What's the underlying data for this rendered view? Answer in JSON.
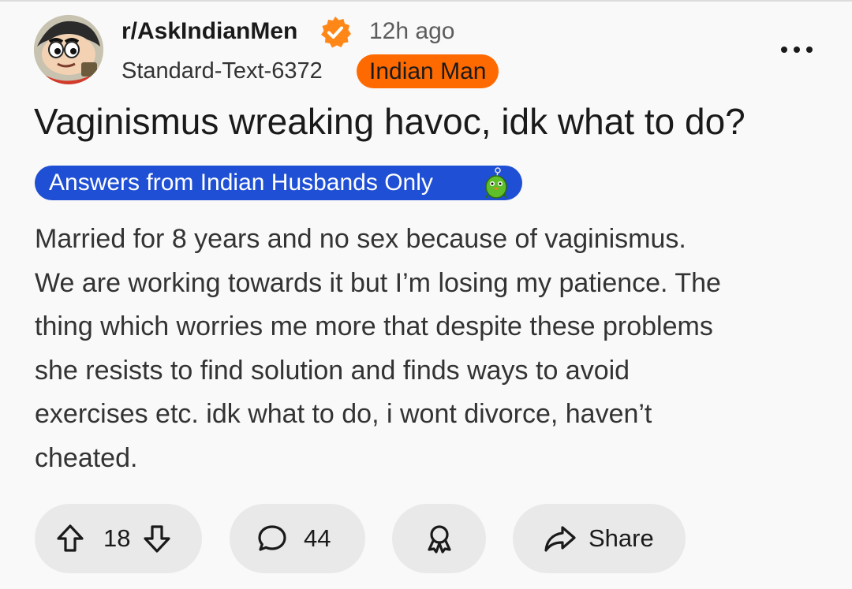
{
  "post": {
    "subreddit": "r/AskIndianMen",
    "time_ago": "12h ago",
    "username": "Standard-Text-6372",
    "user_flair": "Indian Man",
    "title": "Vaginismus wreaking havoc, idk what to do?",
    "post_flair": "Answers from Indian Husbands Only",
    "body_lines": [
      "Married for 8 years and no sex because of vaginismus.",
      "We are working towards it but I’m losing my patience. The",
      "thing which worries me more that despite these problems",
      "she resists to find solution and finds ways to avoid",
      "exercises etc. idk what to do, i wont divorce, haven’t",
      "cheated."
    ]
  },
  "actions": {
    "upvotes": "18",
    "comments": "44",
    "share_label": "Share"
  },
  "icons": {
    "verified": "verified-badge-icon",
    "more": "more-options-icon",
    "upvote": "upvote-arrow-icon",
    "downvote": "downvote-arrow-icon",
    "comment": "comment-bubble-icon",
    "award": "award-ribbon-icon",
    "share": "share-arrow-icon",
    "flair_emoji": "green-parrot-icon"
  },
  "colors": {
    "user_flair_bg": "#ff6a00",
    "post_flair_bg": "#1f4fd4",
    "verified_badge": "#ff8717",
    "action_pill_bg": "#e9e9e9",
    "page_bg": "#f9f9f9"
  }
}
